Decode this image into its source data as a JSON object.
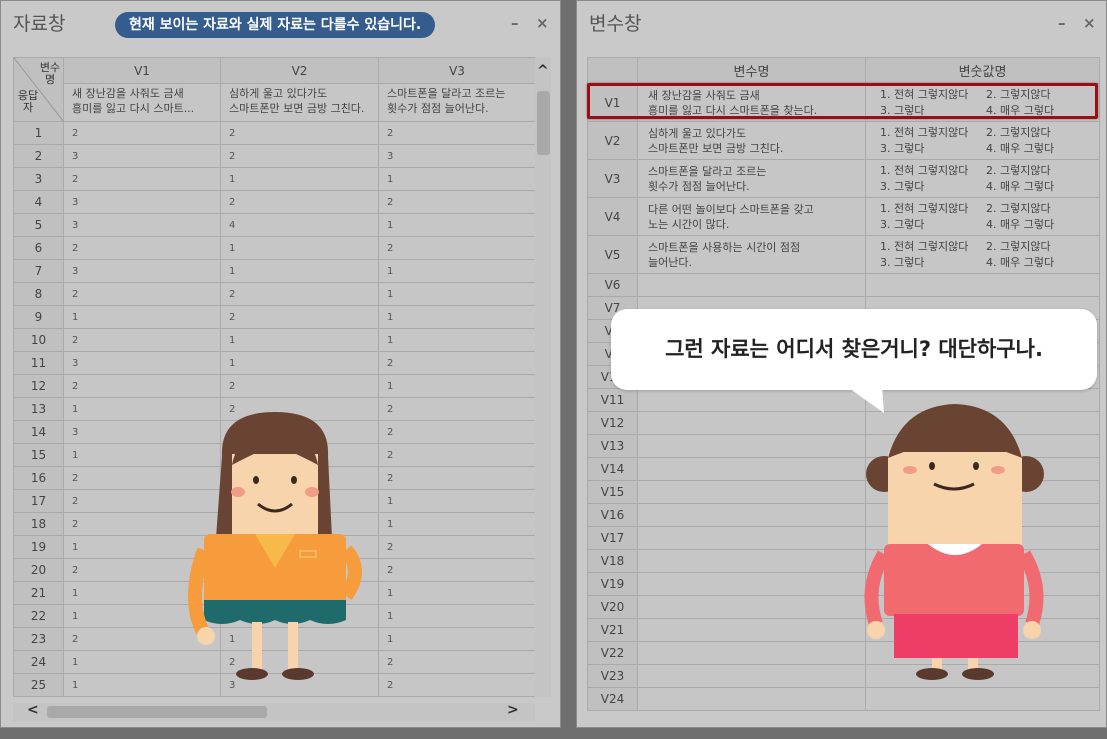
{
  "data_window": {
    "title": "자료창",
    "notice": "현재 보이는 자료와 실제 자료는 다를수 있습니다.",
    "minimize": "–",
    "close": "×",
    "corner_top": "변수명",
    "corner_bottom": "응답자",
    "columns": [
      {
        "name": "V1",
        "desc1": "새 장난감을 사줘도 금새",
        "desc2": "흥미를 잃고 다시 스마트..."
      },
      {
        "name": "V2",
        "desc1": "심하게 울고 있다가도",
        "desc2": "스마트폰만 보면 금방 그친다."
      },
      {
        "name": "V3",
        "desc1": "스마트폰을 달라고 조르는",
        "desc2": "횟수가 점점 늘어난다."
      }
    ],
    "rows": [
      {
        "n": "1",
        "v": [
          "2",
          "2",
          "2"
        ]
      },
      {
        "n": "2",
        "v": [
          "3",
          "2",
          "3"
        ]
      },
      {
        "n": "3",
        "v": [
          "2",
          "1",
          "1"
        ]
      },
      {
        "n": "4",
        "v": [
          "3",
          "2",
          "2"
        ]
      },
      {
        "n": "5",
        "v": [
          "3",
          "4",
          "1"
        ]
      },
      {
        "n": "6",
        "v": [
          "2",
          "1",
          "2"
        ]
      },
      {
        "n": "7",
        "v": [
          "3",
          "1",
          "1"
        ]
      },
      {
        "n": "8",
        "v": [
          "2",
          "2",
          "1"
        ]
      },
      {
        "n": "9",
        "v": [
          "1",
          "2",
          "1"
        ]
      },
      {
        "n": "10",
        "v": [
          "2",
          "1",
          "1"
        ]
      },
      {
        "n": "11",
        "v": [
          "3",
          "1",
          "2"
        ]
      },
      {
        "n": "12",
        "v": [
          "2",
          "2",
          "1"
        ]
      },
      {
        "n": "13",
        "v": [
          "1",
          "2",
          "2"
        ]
      },
      {
        "n": "14",
        "v": [
          "3",
          "",
          "2"
        ]
      },
      {
        "n": "15",
        "v": [
          "1",
          "",
          "2"
        ]
      },
      {
        "n": "16",
        "v": [
          "2",
          "",
          "2"
        ]
      },
      {
        "n": "17",
        "v": [
          "2",
          "",
          "1"
        ]
      },
      {
        "n": "18",
        "v": [
          "2",
          "",
          "1"
        ]
      },
      {
        "n": "19",
        "v": [
          "1",
          "",
          "2"
        ]
      },
      {
        "n": "20",
        "v": [
          "2",
          "",
          "2"
        ]
      },
      {
        "n": "21",
        "v": [
          "1",
          "",
          "1"
        ]
      },
      {
        "n": "22",
        "v": [
          "1",
          "",
          "1"
        ]
      },
      {
        "n": "23",
        "v": [
          "2",
          "1",
          "1"
        ]
      },
      {
        "n": "24",
        "v": [
          "1",
          "2",
          "2"
        ]
      },
      {
        "n": "25",
        "v": [
          "1",
          "3",
          "2"
        ]
      }
    ],
    "scroll_up": "^",
    "scroll_left": "<",
    "scroll_right": ">"
  },
  "variable_window": {
    "title": "변수창",
    "minimize": "–",
    "close": "×",
    "header_name": "변수명",
    "header_values": "변숫값명",
    "defined": [
      {
        "name": "V1",
        "label1": "새 장난감을 사줘도 금새",
        "label2": "흥미를 잃고 다시 스마트폰을 찾는다.",
        "values": [
          "1. 전혀 그렇지않다",
          "2. 그렇지않다",
          "3. 그렇다",
          "4. 매우 그렇다"
        ]
      },
      {
        "name": "V2",
        "label1": "심하게 울고 있다가도",
        "label2": "스마트폰만 보면 금방 그친다.",
        "values": [
          "1. 전혀 그렇지않다",
          "2. 그렇지않다",
          "3. 그렇다",
          "4. 매우 그렇다"
        ]
      },
      {
        "name": "V3",
        "label1": "스마트폰을 달라고 조르는",
        "label2": "횟수가 점점 늘어난다.",
        "values": [
          "1. 전혀 그렇지않다",
          "2. 그렇지않다",
          "3. 그렇다",
          "4. 매우 그렇다"
        ]
      },
      {
        "name": "V4",
        "label1": "다른 어떤 놀이보다 스마트폰을 갖고",
        "label2": "노는 시간이 많다.",
        "values": [
          "1. 전혀 그렇지않다",
          "2. 그렇지않다",
          "3. 그렇다",
          "4. 매우 그렇다"
        ]
      },
      {
        "name": "V5",
        "label1": "스마트폰을 사용하는 시간이 점점",
        "label2": "늘어난다.",
        "values": [
          "1. 전혀 그렇지않다",
          "2. 그렇지않다",
          "3. 그렇다",
          "4. 매우 그렇다"
        ]
      }
    ],
    "empty": [
      "V6",
      "V7",
      "V8",
      "V9",
      "V10",
      "V11",
      "V12",
      "V13",
      "V14",
      "V15",
      "V16",
      "V17",
      "V18",
      "V19",
      "V20",
      "V21",
      "V22",
      "V23",
      "V24"
    ]
  },
  "speech_bubble": {
    "text": "그런 자료는 어디서 찾은거니? 대단하구나."
  }
}
